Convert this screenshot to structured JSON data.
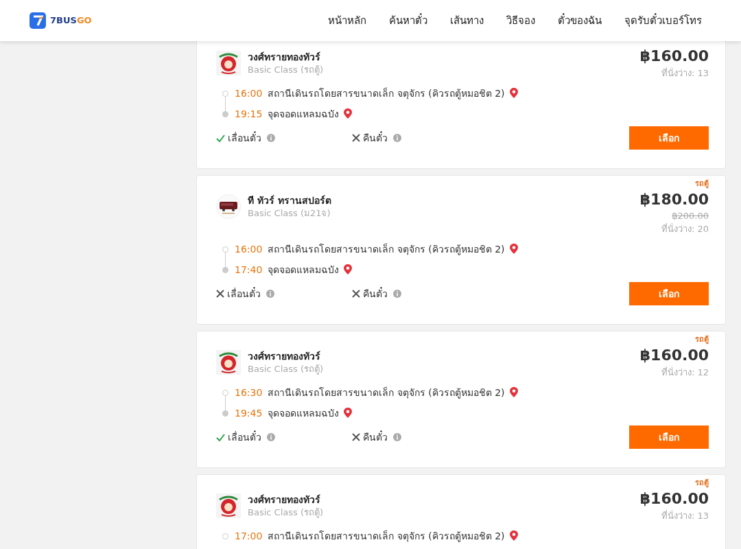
{
  "header": {
    "logo_text_a": "7BUS",
    "logo_text_b": "GO",
    "nav": [
      {
        "label": "หน้าหลัก"
      },
      {
        "label": "ค้นหาตั๋ว"
      },
      {
        "label": "เส้นทาง"
      },
      {
        "label": "วิธีจอง"
      },
      {
        "label": "ตั๋วของฉัน"
      },
      {
        "label": "จุดรับตั๋วเบอร์โทร"
      }
    ]
  },
  "trips": [
    {
      "operator": "วงศ์ทรายทองทัวร์",
      "kind": "lion",
      "class": "Basic Class (รถตู้)",
      "price": "฿160.00",
      "seats": "ที่นั่งว่าง: 13",
      "stops": [
        {
          "time": "16:00",
          "place": "สถานีเดินรถโดยสารขนาดเล็ก จตุจักร (คิวรถตู้หมอชิต 2)"
        },
        {
          "time": "19:15",
          "place": "จุดจอดแหลมฉบัง"
        }
      ],
      "features": [
        {
          "label": "เลื่อนตั๋ว",
          "available": true
        },
        {
          "label": "คืนตั๋ว",
          "available": false
        }
      ],
      "button": "เลือก"
    },
    {
      "tag": "รถตู้",
      "operator": "ที ทัวร์ ทรานสปอร์ต",
      "kind": "bus",
      "class": "Basic Class (ม21จ)",
      "price": "฿180.00",
      "original_price": "฿200.00",
      "seats": "ที่นั่งว่าง: 20",
      "stops": [
        {
          "time": "16:00",
          "place": "สถานีเดินรถโดยสารขนาดเล็ก จตุจักร (คิวรถตู้หมอชิต 2)"
        },
        {
          "time": "17:40",
          "place": "จุดจอดแหลมฉบัง"
        }
      ],
      "features": [
        {
          "label": "เลื่อนตั๋ว",
          "available": false
        },
        {
          "label": "คืนตั๋ว",
          "available": false
        }
      ],
      "button": "เลือก"
    },
    {
      "tag": "รถตู้",
      "operator": "วงศ์ทรายทองทัวร์",
      "kind": "lion",
      "class": "Basic Class (รถตู้)",
      "price": "฿160.00",
      "seats": "ที่นั่งว่าง: 12",
      "stops": [
        {
          "time": "16:30",
          "place": "สถานีเดินรถโดยสารขนาดเล็ก จตุจักร (คิวรถตู้หมอชิต 2)"
        },
        {
          "time": "19:45",
          "place": "จุดจอดแหลมฉบัง"
        }
      ],
      "features": [
        {
          "label": "เลื่อนตั๋ว",
          "available": true
        },
        {
          "label": "คืนตั๋ว",
          "available": false
        }
      ],
      "button": "เลือก"
    },
    {
      "tag": "รถตู้",
      "operator": "วงศ์ทรายทองทัวร์",
      "kind": "lion",
      "class": "Basic Class (รถตู้)",
      "price": "฿160.00",
      "seats": "ที่นั่งว่าง: 13",
      "stops": [
        {
          "time": "17:00",
          "place": "สถานีเดินรถโดยสารขนาดเล็ก จตุจักร (คิวรถตู้หมอชิต 2)"
        }
      ]
    }
  ]
}
